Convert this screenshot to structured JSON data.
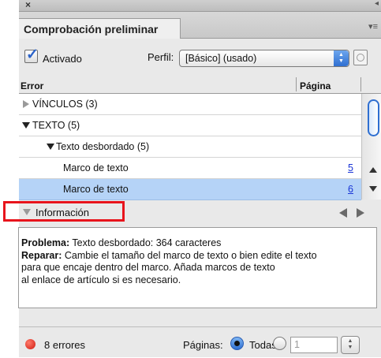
{
  "panel": {
    "close_icon": "×",
    "tab_title": "Comprobación preliminar"
  },
  "controls": {
    "activado_label": "Activado",
    "activado_checked": true,
    "perfil_label": "Perfil:",
    "perfil_value": "[Básico] (usado)"
  },
  "table": {
    "col_error": "Error",
    "col_pagina": "Página",
    "rows": [
      {
        "label": "VÍNCULOS (3)",
        "page": ""
      },
      {
        "label": "TEXTO (5)",
        "page": ""
      },
      {
        "label": "Texto desbordado (5)",
        "page": ""
      },
      {
        "label": "Marco de texto",
        "page": "5"
      },
      {
        "label": "Marco de texto",
        "page": "6"
      }
    ]
  },
  "info": {
    "header_label": "Información",
    "problema_label": "Problema:",
    "problema_text": " Texto desbordado: 364 caracteres",
    "reparar_label": "Reparar:",
    "reparar_line1": " Cambie el tamaño del marco de texto o bien edite el texto",
    "reparar_line2": "para que encaje dentro del marco. Añada marcos de texto",
    "reparar_line3": "al enlace de artículo si es necesario."
  },
  "footer": {
    "errors_count": "8 errores",
    "paginas_label": "Páginas:",
    "todas_label": "Todas",
    "page_range_value": "1"
  },
  "colors": {
    "selection": "#b5d3f7",
    "accent_blue": "#2f6fd1",
    "error_red": "#d01b10",
    "highlight_box": "#e8141c",
    "link": "#1a35d6"
  }
}
